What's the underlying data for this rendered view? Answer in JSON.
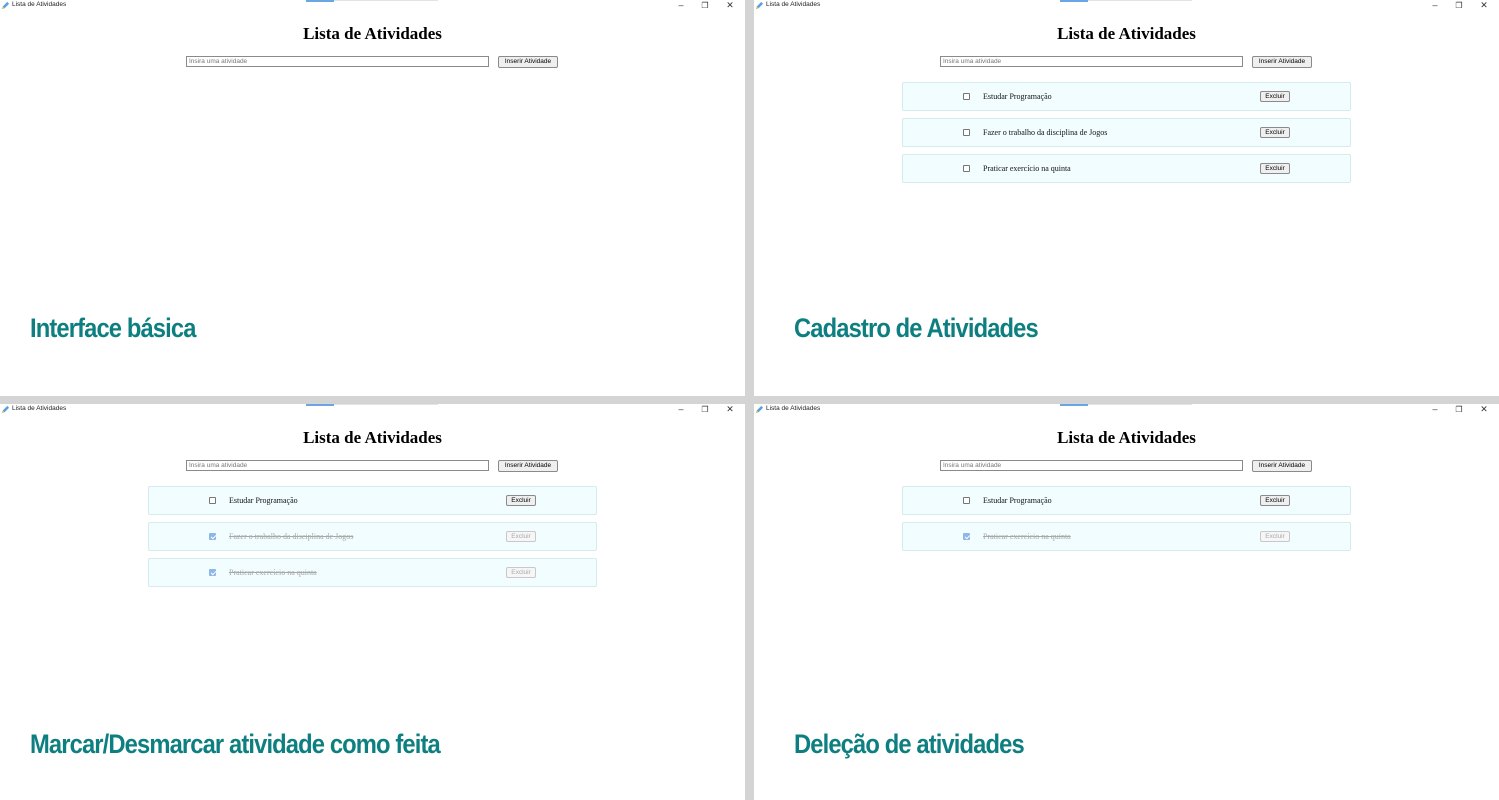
{
  "colors": {
    "caption": "#0e7f80",
    "item_background": "#f2fdff",
    "checkbox_checked": "#8fb6e8",
    "divider": "#d4d4d4"
  },
  "window": {
    "title": "Lista de Atividades",
    "app_icon": "pencil-icon",
    "minimize_glyph": "–",
    "maximize_glyph": "❐",
    "close_glyph": "✕"
  },
  "page": {
    "title": "Lista de Atividades",
    "input_placeholder": "Insira uma atividade",
    "insert_button": "Inserir Atividade",
    "delete_button": "Excluir"
  },
  "panels": [
    {
      "caption": "Interface básica",
      "tasks": []
    },
    {
      "caption": "Cadastro de Atividades",
      "tasks": [
        {
          "text": "Estudar Programação",
          "done": false
        },
        {
          "text": "Fazer o trabalho da disciplina de Jogos",
          "done": false
        },
        {
          "text": "Praticar exercício na quinta",
          "done": false
        }
      ]
    },
    {
      "caption": "Marcar/Desmarcar atividade como feita",
      "tasks": [
        {
          "text": "Estudar Programação",
          "done": false
        },
        {
          "text": "Fazer o trabalho da disciplina de Jogos",
          "done": true
        },
        {
          "text": "Praticar exercício na quinta",
          "done": true
        }
      ]
    },
    {
      "caption": "Deleção de atividades",
      "tasks": [
        {
          "text": "Estudar Programação",
          "done": false
        },
        {
          "text": "Praticar exercício na quinta",
          "done": true
        }
      ]
    }
  ]
}
